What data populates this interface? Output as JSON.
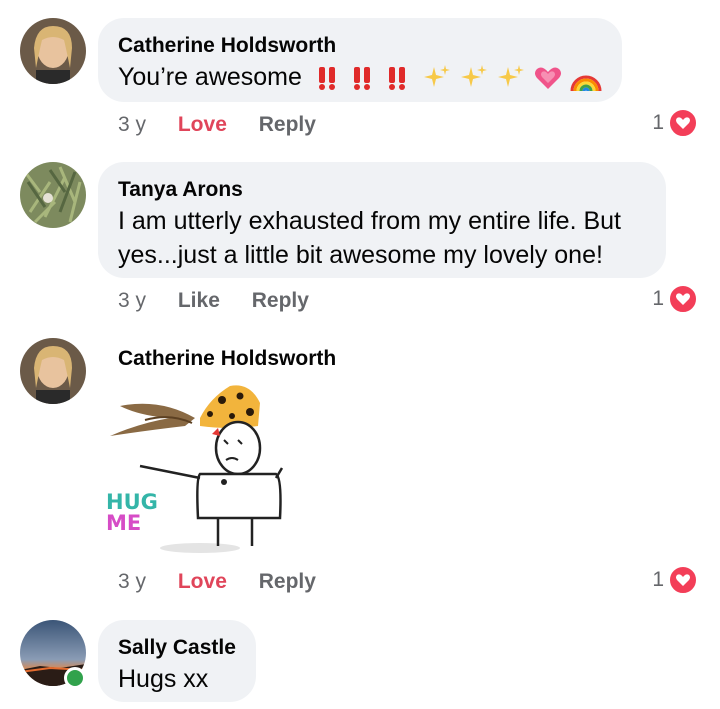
{
  "comments": [
    {
      "author": "Catherine Holdsworth",
      "text": "You’re awesome",
      "emoji_icons": [
        "double-exclamation-icon",
        "double-exclamation-icon",
        "double-exclamation-icon",
        "sparkles-icon",
        "sparkles-icon",
        "sparkles-icon",
        "growing-heart-icon",
        "rainbow-icon"
      ],
      "time": "3 y",
      "action1": "Love",
      "action2": "Reply",
      "reactions": "1"
    },
    {
      "author": "Tanya Arons",
      "text_line1": "I am utterly exhausted from my entire life.  But",
      "text_line2": "yes...just a little bit awesome my lovely one!",
      "time": "3 y",
      "action1": "Like",
      "action2": "Reply",
      "reactions": "1"
    },
    {
      "author": "Catherine Holdsworth",
      "sticker_text": "HUG ME",
      "sticker_word1": "HUG",
      "sticker_word2": "ME",
      "time": "3 y",
      "action1": "Love",
      "action2": "Reply",
      "reactions": "1"
    },
    {
      "author": "Sally Castle",
      "text": "Hugs xx"
    }
  ],
  "colors": {
    "bubble": "#f0f2f5",
    "love": "#e0455a",
    "muted": "#65676b",
    "heart": "#f33e58",
    "online": "#31a24c"
  }
}
